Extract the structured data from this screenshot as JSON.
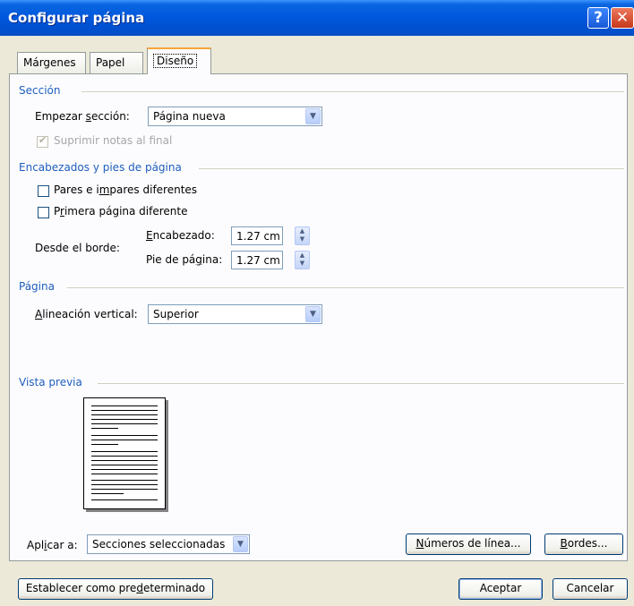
{
  "window": {
    "title": "Configurar página"
  },
  "titlebar": {
    "help_glyph": "?",
    "close_glyph": "✕"
  },
  "tabs": [
    {
      "label": "Márgenes"
    },
    {
      "label": "Papel"
    },
    {
      "label": "Diseño",
      "active": true
    }
  ],
  "seccion": {
    "group_label": "Sección",
    "start_label_pre": "Empezar ",
    "start_label_u": "s",
    "start_label_post": "ección:",
    "start_value": "Página nueva",
    "suppress_label": "Suprimir notas al final",
    "suppress_checked": true,
    "suppress_disabled": true
  },
  "headers": {
    "group_label": "Encabezados y pies de página",
    "odd_even_pre": "Pares e i",
    "odd_even_u": "m",
    "odd_even_post": "pares diferentes",
    "first_page_pre": "P",
    "first_page_u": "r",
    "first_page_post": "imera página diferente",
    "from_edge_label": "Desde el borde:",
    "header_label_u": "E",
    "header_label_post": "ncabezado:",
    "header_value": "1.27 cm",
    "footer_label_pre": "Pie de pá",
    "footer_label_u": "g",
    "footer_label_post": "ina:",
    "footer_value": "1.27 cm"
  },
  "pagina": {
    "group_label": "Página",
    "valign_label_u": "A",
    "valign_label_post": "lineación vertical:",
    "valign_value": "Superior"
  },
  "preview": {
    "group_label": "Vista previa"
  },
  "apply": {
    "label_pre": "Apl",
    "label_u": "i",
    "label_post": "car a:",
    "value": "Secciones seleccionadas"
  },
  "buttons": {
    "line_numbers_u": "N",
    "line_numbers_post": "úmeros de línea...",
    "borders_u": "B",
    "borders_post": "ordes...",
    "default_pre": "Establecer como pre",
    "default_u": "d",
    "default_post": "eterminado",
    "ok": "Aceptar",
    "cancel": "Cancelar"
  },
  "colors": {
    "group_label": "#1e5ebd",
    "titlebar": "#0058dd",
    "dialog_bg": "#ece9d8"
  },
  "icons": [
    "help-icon",
    "close-icon",
    "dropdown-arrow-icon",
    "spin-up-icon",
    "spin-down-icon",
    "checkmark-icon"
  ]
}
